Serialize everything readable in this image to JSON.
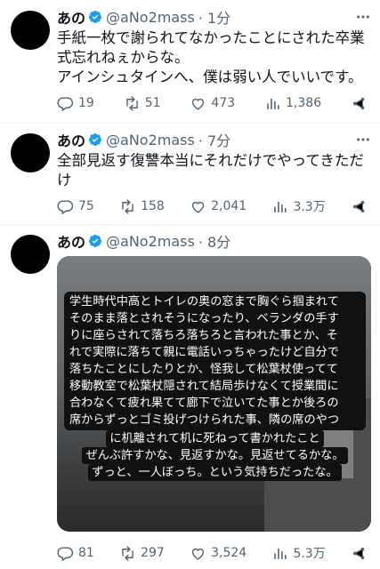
{
  "tweets": [
    {
      "name": "あの",
      "handle": "@aNo2mass",
      "time": "· 1分",
      "lines": [
        "手紙一枚で謝られてなかったことにされた卒業",
        "式忘れねぇからな。",
        "アインシュタインへ、僕は弱い人でいいです。"
      ],
      "replies": "19",
      "retweets": "51",
      "likes": "473",
      "views": "1,386"
    },
    {
      "name": "あの",
      "handle": "@aNo2mass",
      "time": "· 7分",
      "lines": [
        "全部見返す復讐本当にそれだけでやってきただ",
        "け"
      ],
      "replies": "75",
      "retweets": "158",
      "likes": "2,041",
      "views": "3.3万"
    },
    {
      "name": "あの",
      "handle": "@aNo2mass",
      "time": "· 8分",
      "image_text": [
        "学生時代中高とトイレの奥の窓まで胸ぐら掴まれて",
        "そのまま落とされそうになったり、ベランダの手す",
        "りに座らされて落ちろ落ちろと言われた事とか、そ",
        "れで実際に落ちて親に電話いっちゃったけど自分で",
        "落ちたことにしたりとか、怪我して松葉杖使ってて",
        "移動教室で松葉杖隠されて結局歩けなくて授業間に",
        "合わなくて疲れ果てて廊下で泣いてた事とか後ろの",
        "席からずっとゴミ投げつけられた事、隣の席のやつ",
        "に机離されて机に死ねって書かれたこと",
        "ぜんぶ許すかな、見返すかな。見返せてるかな。",
        "ずっと、一人ぼっち。という気持ちだったな。"
      ],
      "replies": "81",
      "retweets": "297",
      "likes": "3,524",
      "views": "5.3万"
    }
  ],
  "colors": {
    "verified": "#1d9bf0",
    "muted": "#536471"
  }
}
